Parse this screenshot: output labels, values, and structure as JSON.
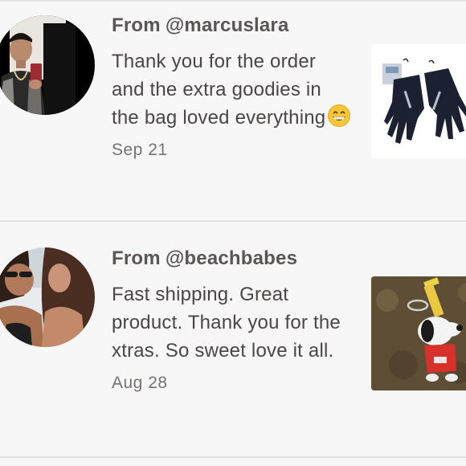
{
  "reviews": [
    {
      "from_prefix": "From",
      "username": "@marcuslara",
      "text": "Thank you for the order and the extra goodies in the bag loved everything",
      "emoji": "grinning-face",
      "date": "Sep 21",
      "product_image": "black-gloves"
    },
    {
      "from_prefix": "From",
      "username": "@beachbabes",
      "text": "Fast shipping. Great product. Thank you for the xtras. So sweet love it all.",
      "date": "Aug 28",
      "product_image": "snoopy-keychain"
    }
  ]
}
